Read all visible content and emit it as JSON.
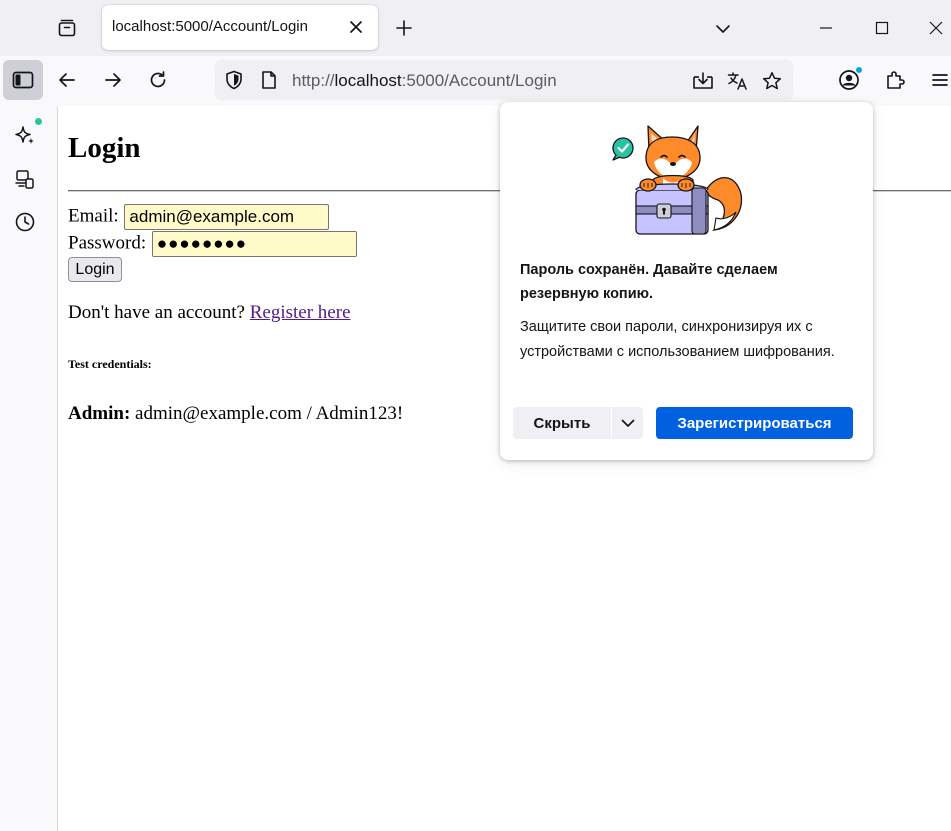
{
  "browser": {
    "tab": {
      "title": "localhost:5000/Account/Login"
    },
    "url": {
      "prefix": "http://",
      "host": "localhost",
      "rest": ":5000/Account/Login"
    }
  },
  "page": {
    "heading": "Login",
    "email_label": "Email:",
    "email_value": "admin@example.com",
    "password_label": "Password:",
    "password_value": "●●●●●●●●",
    "login_button": "Login",
    "register_prompt": "Don't have an account?",
    "register_link": "Register here",
    "test_credentials_heading": "Test credentials:",
    "admin_label": "Admin:",
    "admin_credentials": "admin@example.com / Admin123!"
  },
  "popup": {
    "title": "Пароль сохранён. Давайте сделаем резервную копию.",
    "body": "Защитите свои пароли, синхронизируя их с устройствами с использованием шифрования.",
    "hide_button": "Скрыть",
    "register_button": "Зарегистрироваться"
  },
  "colors": {
    "accent_button": "#0061e0",
    "autofill_field": "#fffac8",
    "link_visited": "#551a8b"
  },
  "icons": [
    "tab-overview-icon",
    "close-icon",
    "plus-icon",
    "chevron-down-icon",
    "minimize-icon",
    "maximize-icon",
    "window-close-icon",
    "sidebar-icon",
    "back-arrow-icon",
    "forward-arrow-icon",
    "reload-icon",
    "shield-icon",
    "page-icon",
    "save-to-pocket-icon",
    "translate-icon",
    "star-icon",
    "account-icon",
    "extensions-icon",
    "menu-icon",
    "ai-sparkle-icon",
    "synced-tabs-icon",
    "history-icon",
    "fox-illustration"
  ]
}
